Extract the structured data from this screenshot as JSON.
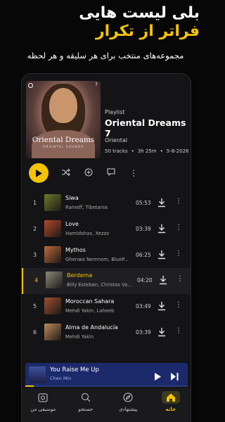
{
  "hero": {
    "title_line1": "بلی لیست هایی",
    "title_line2": "فراتر از تکرار",
    "subtitle": "مجموعه‌های منتخب برای هر سلیقه و هر لحظه"
  },
  "playlist": {
    "label": "Playlist",
    "title": "Oriental Dreams 7",
    "artist": "Oriental",
    "tracks_count": "50 tracks",
    "duration": "3h 25m",
    "date": "5-8-2026",
    "cover_title": "Oriental Dreams",
    "cover_subtitle": "ORIENTAL SOUNDS",
    "cover_badge": "7"
  },
  "tracks": [
    {
      "num": "1",
      "title": "Siwa",
      "artist": "Rameff, Tibetania",
      "time": "05:53",
      "color": "#6c7a2a"
    },
    {
      "num": "2",
      "title": "Love",
      "artist": "Hamidshax, Xezzo",
      "time": "03:39",
      "color": "#b24a28"
    },
    {
      "num": "3",
      "title": "Mythos",
      "artist": "Ghenwa Nemnom, BlueP...",
      "time": "06:25",
      "color": "#c06a3a"
    },
    {
      "num": "4",
      "title": "Berdema",
      "artist": "Billy Esteban, Christos Vo...",
      "time": "04:20",
      "color": "#8a8a7a"
    },
    {
      "num": "5",
      "title": "Moroccan Sahara",
      "artist": "Mehdi Yakin, Laheeb",
      "time": "03:49",
      "color": "#a05030"
    },
    {
      "num": "6",
      "title": "Alma de Andalucía",
      "artist": "Mehdi Yakin",
      "time": "03:39",
      "color": "#c08a5a"
    }
  ],
  "active_track_index": 3,
  "mini_player": {
    "title": "You Raise Me Up",
    "artist": "Chen Min",
    "progress": 0.05
  },
  "nav": [
    {
      "label": "موسیقی من",
      "icon": "library-icon"
    },
    {
      "label": "جستجو",
      "icon": "search-icon"
    },
    {
      "label": "پیشنهادی",
      "icon": "compass-icon"
    },
    {
      "label": "خانه",
      "icon": "home-icon",
      "active": true
    }
  ],
  "colors": {
    "accent": "#f5c400",
    "mini_player": "#1c2a6b",
    "background": "#070708"
  }
}
